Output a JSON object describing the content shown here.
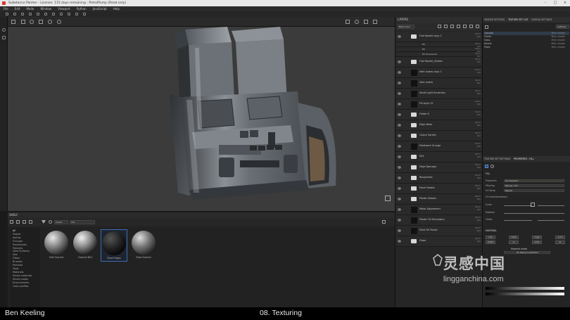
{
  "window": {
    "title": "Substance Painter - License: 115 days remaining - PetrolPump (Read only)"
  },
  "menu": [
    "File",
    "Edit",
    "Mode",
    "Window",
    "Viewport",
    "Python",
    "JavaScript",
    "Help"
  ],
  "viewport": {
    "mode": "Material"
  },
  "shelf": {
    "title": "SHELF",
    "search": "dirt",
    "filter_tag": "Smart",
    "categories": [
      "All",
      "Project",
      "Alphas",
      "Grunges",
      "Procedurals",
      "Textures",
      "Hard Surfaces",
      "Skin",
      "Filters",
      "Brushes",
      "Particles",
      "Tools",
      "Materials",
      "Smart materials",
      "Smart masks",
      "Environments",
      "Color profiles"
    ],
    "materials": [
      {
        "name": "Dirt Ground"
      },
      {
        "name": "Ground Dirt"
      },
      {
        "name": "Dust Edges"
      },
      {
        "name": "Rust Ground"
      }
    ]
  },
  "layers": {
    "title": "LAYERS",
    "blend_mode": "Base Color",
    "rows": [
      {
        "name": "Fuel Nozzle copy 1",
        "type": "folder",
        "blend": "Norm",
        "opacity": "100"
      },
      {
        "name": "Fill",
        "type": "sub",
        "blend": "Norm",
        "opacity": "100"
      },
      {
        "name": "Fill",
        "type": "sub",
        "blend": "Norm",
        "opacity": "100"
      },
      {
        "name": "Fill Procedural",
        "type": "sub",
        "blend": "Norm",
        "opacity": "100"
      },
      {
        "name": "Fuel Nozzle_Shader",
        "type": "folder",
        "blend": "Norm",
        "opacity": "100"
      },
      {
        "name": "Vent scales copy 1",
        "type": "layer",
        "blend": "Norm",
        "opacity": "100"
      },
      {
        "name": "Vent scales",
        "type": "layer",
        "blend": "Norm",
        "opacity": "100"
      },
      {
        "name": "Small Light Scratches",
        "type": "layer",
        "blend": "Norm",
        "opacity": "100"
      },
      {
        "name": "Fill layer 22",
        "type": "layer",
        "blend": "Norm",
        "opacity": "100"
      },
      {
        "name": "Folder 6",
        "type": "folder",
        "blend": "Norm",
        "opacity": "100"
      },
      {
        "name": "Edge Wear",
        "type": "folder",
        "blend": "Norm",
        "opacity": "100"
      },
      {
        "name": "Colour Variety",
        "type": "folder",
        "blend": "Norm",
        "opacity": "100"
      },
      {
        "name": "Paintwork Grunge",
        "type": "layer",
        "blend": "Norm",
        "opacity": "100"
      },
      {
        "name": "Dirt",
        "type": "folder",
        "blend": "Norm",
        "opacity": "100"
      },
      {
        "name": "Edge Damage",
        "type": "folder",
        "blend": "Norm",
        "opacity": "100"
      },
      {
        "name": "Roughness",
        "type": "folder",
        "blend": "Norm",
        "opacity": "100"
      },
      {
        "name": "Panel Details",
        "type": "folder",
        "blend": "Norm",
        "opacity": "100"
      },
      {
        "name": "Plastic Details",
        "type": "folder",
        "blend": "Norm",
        "opacity": "100"
      },
      {
        "name": "Metal Adjustment",
        "type": "layer",
        "blend": "Norm",
        "opacity": "100"
      },
      {
        "name": "Plastic Fill Secondary",
        "type": "layer",
        "blend": "Norm",
        "opacity": "100"
      },
      {
        "name": "Paint Fill Preset",
        "type": "layer",
        "blend": "Norm",
        "opacity": "100"
      },
      {
        "name": "Glass",
        "type": "folder",
        "blend": "Norm",
        "opacity": "100"
      }
    ]
  },
  "right": {
    "tabs": [
      "SHADER SETTINGS",
      "TEXTURE SET LIST",
      "DISPLAY SETTINGS"
    ],
    "settings_label": "Settings",
    "texture_sets": [
      {
        "name": "Console",
        "shader": "Main shader"
      },
      {
        "name": "Frame",
        "shader": "Main shader"
      },
      {
        "name": "Glass",
        "shader": "Main shader"
      },
      {
        "name": "Nozzle",
        "shader": "Main shader"
      },
      {
        "name": "Pipes",
        "shader": "Main shader"
      }
    ],
    "prop_tabs": [
      "TEXTURE SET SETTINGS",
      "PROPERTIES - FILL"
    ],
    "fill": {
      "section": "FILL",
      "projection_label": "Projection",
      "projection": "UV projection",
      "filtering_label": "Filtering",
      "filtering": "Bilinear | HQ",
      "uvwrap_label": "UV Wrap",
      "uvwrap": "Repeat",
      "uvtrans_label": "UV transformations",
      "scale_label": "Scale",
      "rotation_label": "Rotation",
      "offset_label": "Offset"
    },
    "material": {
      "section": "MATERIAL",
      "channels": [
        "color",
        "metal",
        "rough",
        "norm",
        "height",
        "op",
        "emiss",
        "ao"
      ],
      "mode_label": "Material mode",
      "mode_value": "No Resource Selected"
    }
  },
  "footer": {
    "author": "Ben Keeling",
    "chapter": "08. Texturing"
  },
  "watermark": {
    "line1": "灵感中国",
    "line2": "lingganchina.com"
  }
}
